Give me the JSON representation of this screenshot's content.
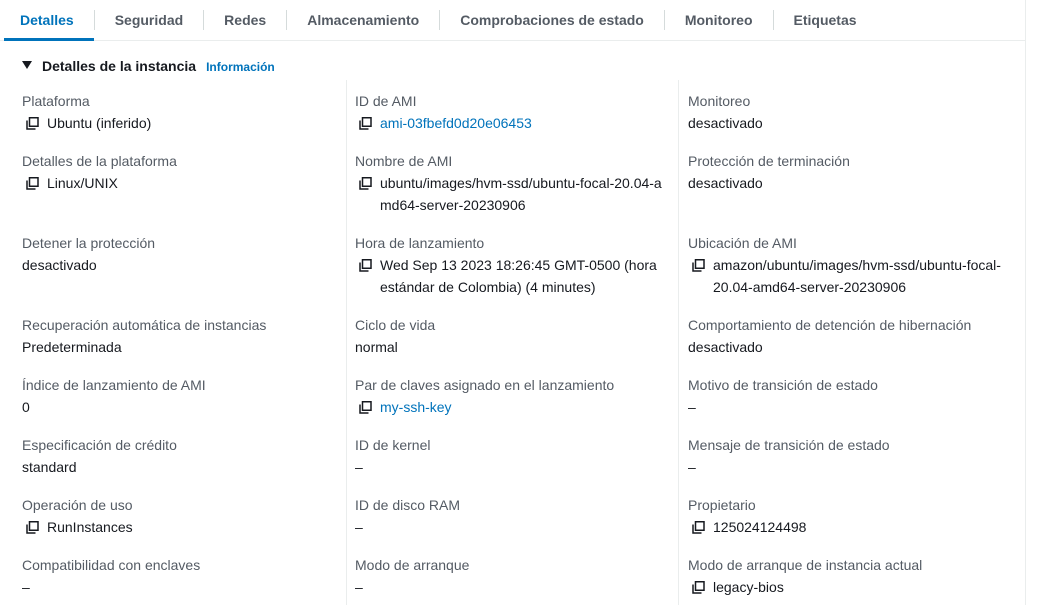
{
  "tabs": [
    {
      "label": "Detalles"
    },
    {
      "label": "Seguridad"
    },
    {
      "label": "Redes"
    },
    {
      "label": "Almacenamiento"
    },
    {
      "label": "Comprobaciones de estado"
    },
    {
      "label": "Monitoreo"
    },
    {
      "label": "Etiquetas"
    }
  ],
  "section": {
    "title": "Detalles de la instancia",
    "info_link": "Información"
  },
  "fields": {
    "platform": {
      "label": "Plataforma",
      "value": "Ubuntu (inferido)"
    },
    "ami_id": {
      "label": "ID de AMI",
      "value": "ami-03fbefd0d20e06453"
    },
    "monitoring": {
      "label": "Monitoreo",
      "value": "desactivado"
    },
    "platform_details": {
      "label": "Detalles de la plataforma",
      "value": "Linux/UNIX"
    },
    "ami_name": {
      "label": "Nombre de AMI",
      "value": "ubuntu/images/hvm-ssd/ubuntu-focal-20.04-amd64-server-20230906"
    },
    "termination_protection": {
      "label": "Protección de terminación",
      "value": "desactivado"
    },
    "stop_protection": {
      "label": "Detener la protección",
      "value": "desactivado"
    },
    "launch_time": {
      "label": "Hora de lanzamiento",
      "value": "Wed Sep 13 2023 18:26:45 GMT-0500 (hora estándar de Colombia) (4 minutes)"
    },
    "ami_location": {
      "label": "Ubicación de AMI",
      "value": "amazon/ubuntu/images/hvm-ssd/ubuntu-focal-20.04-amd64-server-20230906"
    },
    "auto_recovery": {
      "label": "Recuperación automática de instancias",
      "value": "Predeterminada"
    },
    "lifecycle": {
      "label": "Ciclo de vida",
      "value": "normal"
    },
    "hibernation": {
      "label": "Comportamiento de detención de hibernación",
      "value": "desactivado"
    },
    "ami_launch_index": {
      "label": "Índice de lanzamiento de AMI",
      "value": "0"
    },
    "key_pair": {
      "label": "Par de claves asignado en el lanzamiento",
      "value": "my-ssh-key"
    },
    "state_reason": {
      "label": "Motivo de transición de estado",
      "value": "–"
    },
    "credit_spec": {
      "label": "Especificación de crédito",
      "value": "standard"
    },
    "kernel_id": {
      "label": "ID de kernel",
      "value": "–"
    },
    "state_message": {
      "label": "Mensaje de transición de estado",
      "value": "–"
    },
    "usage_operation": {
      "label": "Operación de uso",
      "value": "RunInstances"
    },
    "ramdisk_id": {
      "label": "ID de disco RAM",
      "value": "–"
    },
    "owner": {
      "label": "Propietario",
      "value": "125024124498"
    },
    "enclave": {
      "label": "Compatibilidad con enclaves",
      "value": "–"
    },
    "boot_mode": {
      "label": "Modo de arranque",
      "value": "–"
    },
    "current_boot_mode": {
      "label": "Modo de arranque de instancia actual",
      "value": "legacy-bios"
    }
  }
}
